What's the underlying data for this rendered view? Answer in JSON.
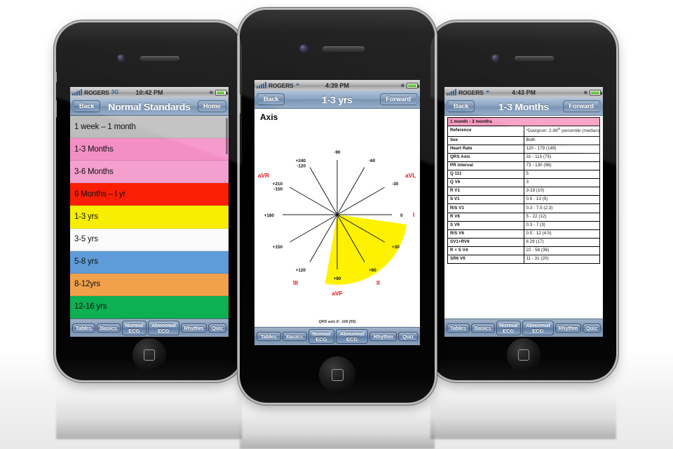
{
  "app": {
    "toolbar_buttons": [
      "Tables",
      "Basics",
      "Normal\nECG",
      "Abnormal\nECG",
      "Rhythm",
      "Quiz"
    ],
    "accent_blue": "#6b88ab",
    "carrier": "ROGERS"
  },
  "phone_left": {
    "status": {
      "carrier": "ROGERS",
      "network": "3G",
      "time": "10:42 PM",
      "wifi": false
    },
    "nav": {
      "back": "Back",
      "title": "Normal Standards",
      "right": "Home"
    },
    "list": [
      {
        "label": "1 week – 1 month",
        "color": "#bdbdbd"
      },
      {
        "label": "1-3 Months",
        "color": "#f48fc5"
      },
      {
        "label": "3-6 Months",
        "color": "#f4a0cf"
      },
      {
        "label": "6 Months – I yr",
        "color": "#fa1e05"
      },
      {
        "label": "1-3 yrs",
        "color": "#f7ee00"
      },
      {
        "label": "3-5 yrs",
        "color": "#fbfbfb"
      },
      {
        "label": "5-8 yrs",
        "color": "#5f9bd6"
      },
      {
        "label": "8-12yrs",
        "color": "#f1a14a"
      },
      {
        "label": "12-16 yrs",
        "color": "#0db052"
      }
    ]
  },
  "phone_center": {
    "status": {
      "carrier": "ROGERS",
      "network": "",
      "time": "4:39 PM",
      "wifi": true
    },
    "nav": {
      "back": "Back",
      "title": "1-3 yrs",
      "right": "Forward"
    },
    "section_title": "Axis",
    "caption": "QRS axis 8 - 100 (55)",
    "sector": {
      "start_deg": 8,
      "end_deg": 100,
      "color": "#fff200"
    },
    "spokes": [
      {
        "deg": -90,
        "label": "-90",
        "side": "top"
      },
      {
        "deg": -60,
        "label": "-60",
        "side": "top"
      },
      {
        "deg": -30,
        "label": "-30",
        "side": "top"
      },
      {
        "deg": 0,
        "label": "0",
        "side": "right"
      },
      {
        "deg": 30,
        "label": "+30",
        "side": "right"
      },
      {
        "deg": 60,
        "label": "+60",
        "side": "right"
      },
      {
        "deg": 90,
        "label": "+90",
        "side": "bottom"
      },
      {
        "deg": 120,
        "label": "+120",
        "side": "bottom"
      },
      {
        "deg": 150,
        "label": "+150",
        "side": "left"
      },
      {
        "deg": 180,
        "label": "+180",
        "side": "left"
      },
      {
        "deg": 210,
        "label": "+210\n-150",
        "side": "left"
      },
      {
        "deg": 240,
        "label": "+240\n-120",
        "side": "top"
      }
    ],
    "leads": [
      {
        "name": "aVR",
        "deg": 210
      },
      {
        "name": "aVL",
        "deg": -30
      },
      {
        "name": "I",
        "deg": 0
      },
      {
        "name": "II",
        "deg": 60
      },
      {
        "name": "III",
        "deg": 120
      },
      {
        "name": "aVF",
        "deg": 90
      }
    ],
    "lead_color": "#e8151f"
  },
  "phone_right": {
    "status": {
      "carrier": "ROGERS",
      "network": "",
      "time": "4:43 PM",
      "wifi": true
    },
    "nav": {
      "back": "Back",
      "title": "1-3 Months",
      "right": "Forward"
    },
    "table": {
      "header": "1 month - 3 months",
      "header_color": "#f79ac0",
      "rows": [
        {
          "label": "Reference",
          "value": "*Davignon: 2-98th percentile  (median)",
          "sup": "th",
          "value_pre": "*Davignon: 2-98",
          "value_post": " percentile  (median)"
        },
        {
          "label": "Sex",
          "value": "Both"
        },
        {
          "label": "Heart Rate",
          "value": "120 - 179 (149)"
        },
        {
          "label": "QRS Axis",
          "value": "31 - 115 (75)"
        },
        {
          "label": "PR interval",
          "value": "73 - 130 (98)"
        },
        {
          "label": "Q 111",
          "value": "5"
        },
        {
          "label": "Q V6",
          "value": "3"
        },
        {
          "label": "R V1",
          "value": "3-19 (10)"
        },
        {
          "label": "S V1",
          "value": "0.5 - 13 (5)"
        },
        {
          "label": "R/S V1",
          "value": "0.3 - 7.5 (2.3)"
        },
        {
          "label": "R V6",
          "value": "5 - 22 (12)"
        },
        {
          "label": "S V6",
          "value": "0.3 - 7 (3)"
        },
        {
          "label": "R/S V6",
          "value": "0.5 - 12 (4.5)"
        },
        {
          "label": "SV1+RV6",
          "value": "6 29 (17)"
        },
        {
          "label": "R + S V4",
          "value": "22 - 58 (36)"
        },
        {
          "label": "SR6 V6",
          "value": "11 - 31 (20)"
        }
      ]
    }
  }
}
